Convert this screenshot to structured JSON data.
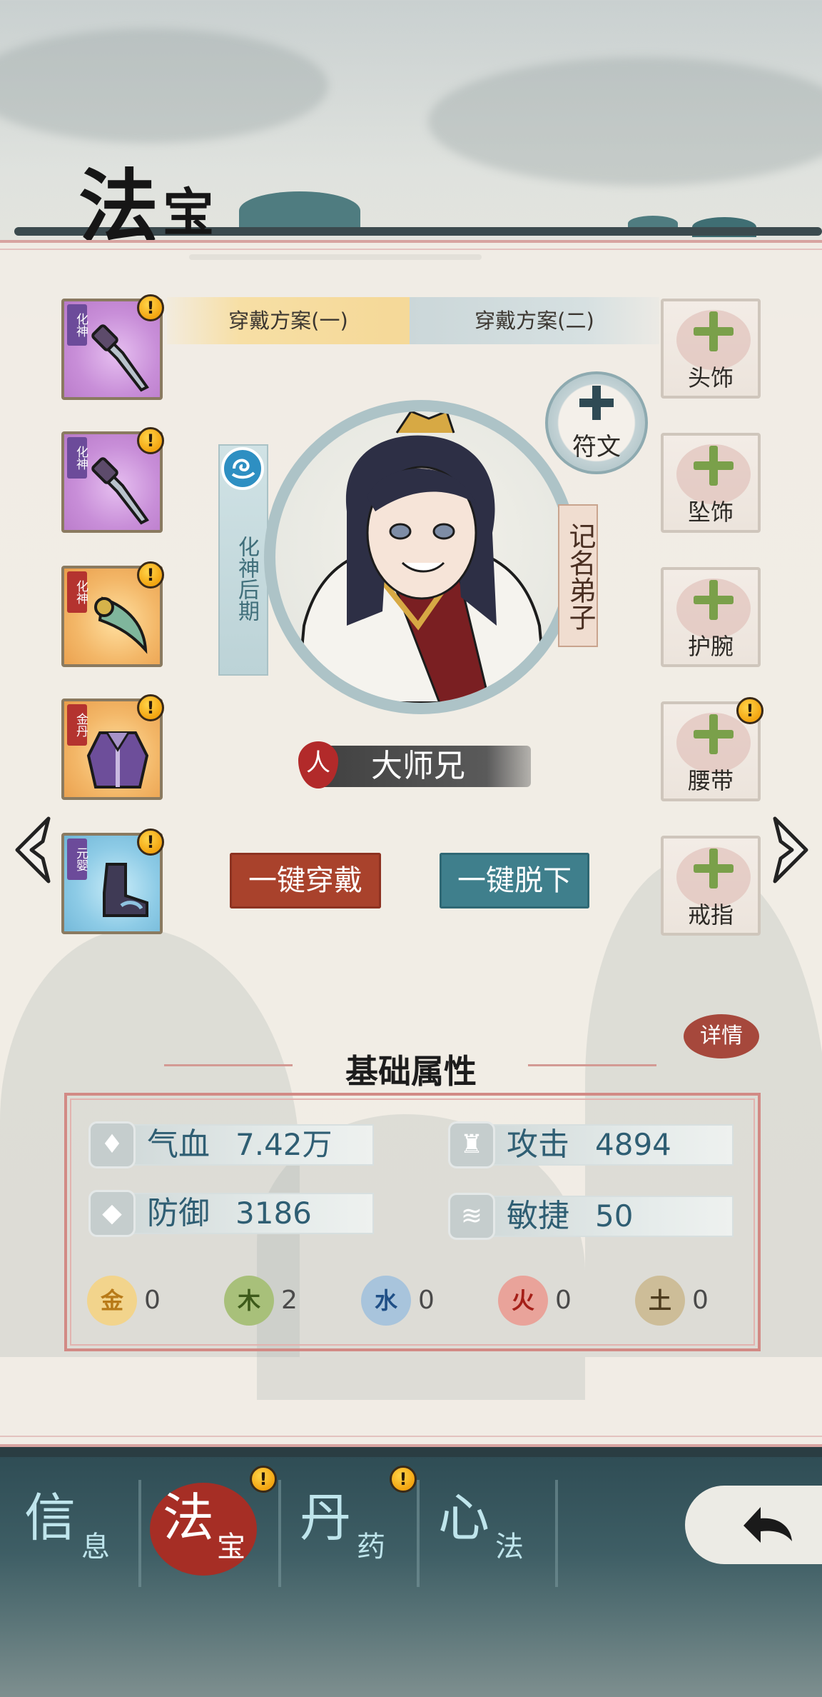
{
  "header": {
    "title_big": "法",
    "title_small": "宝"
  },
  "plans": {
    "tab1": "穿戴方案(一)",
    "tab2": "穿戴方案(二)"
  },
  "left_slots": [
    {
      "tag": "化神",
      "color": "purple",
      "item": "dagger-icon",
      "alert": "!"
    },
    {
      "tag": "化神",
      "color": "purple",
      "item": "dagger-icon",
      "alert": "!"
    },
    {
      "tag": "化神",
      "color": "orange",
      "item": "curved-blade-icon",
      "alert": "!"
    },
    {
      "tag": "金丹",
      "color": "orange",
      "item": "robe-icon",
      "alert": "!"
    },
    {
      "tag": "元婴",
      "color": "blue",
      "item": "boots-icon",
      "alert": "!"
    }
  ],
  "right_slots": [
    {
      "label": "头饰",
      "alert": ""
    },
    {
      "label": "坠饰",
      "alert": ""
    },
    {
      "label": "护腕",
      "alert": ""
    },
    {
      "label": "腰带",
      "alert": "!"
    },
    {
      "label": "戒指",
      "alert": ""
    }
  ],
  "character": {
    "rank": "化神后期",
    "role": "记名弟子",
    "name": "大师兄",
    "name_icon": "人",
    "rune_label": "符文"
  },
  "actions": {
    "equip_all": "一键穿戴",
    "remove_all": "一键脱下"
  },
  "attributes": {
    "title": "基础属性",
    "detail": "详情",
    "stats": [
      {
        "label": "气血",
        "value": "7.42万",
        "icon": "blood-icon"
      },
      {
        "label": "攻击",
        "value": "4894",
        "icon": "attack-icon"
      },
      {
        "label": "防御",
        "value": "3186",
        "icon": "shield-icon"
      },
      {
        "label": "敏捷",
        "value": "50",
        "icon": "agility-icon"
      }
    ],
    "elements": [
      {
        "glyph": "金",
        "value": "0",
        "color": "#e9b04a"
      },
      {
        "glyph": "木",
        "value": "2",
        "color": "#7e9d3e"
      },
      {
        "glyph": "水",
        "value": "0",
        "color": "#4f86b5"
      },
      {
        "glyph": "火",
        "value": "0",
        "color": "#c9463b"
      },
      {
        "glyph": "土",
        "value": "0",
        "color": "#8f7a55"
      }
    ]
  },
  "nav": [
    {
      "big": "信",
      "small": "息",
      "active": false,
      "alert": ""
    },
    {
      "big": "法",
      "small": "宝",
      "active": true,
      "alert": "!"
    },
    {
      "big": "丹",
      "small": "药",
      "active": false,
      "alert": "!"
    },
    {
      "big": "心",
      "small": "法",
      "active": false,
      "alert": ""
    }
  ],
  "colors": {
    "equip_btn": "#a9422c",
    "remove_btn": "#3f7f8c",
    "plus": "#7aa04a",
    "alert": "#f3a410"
  }
}
